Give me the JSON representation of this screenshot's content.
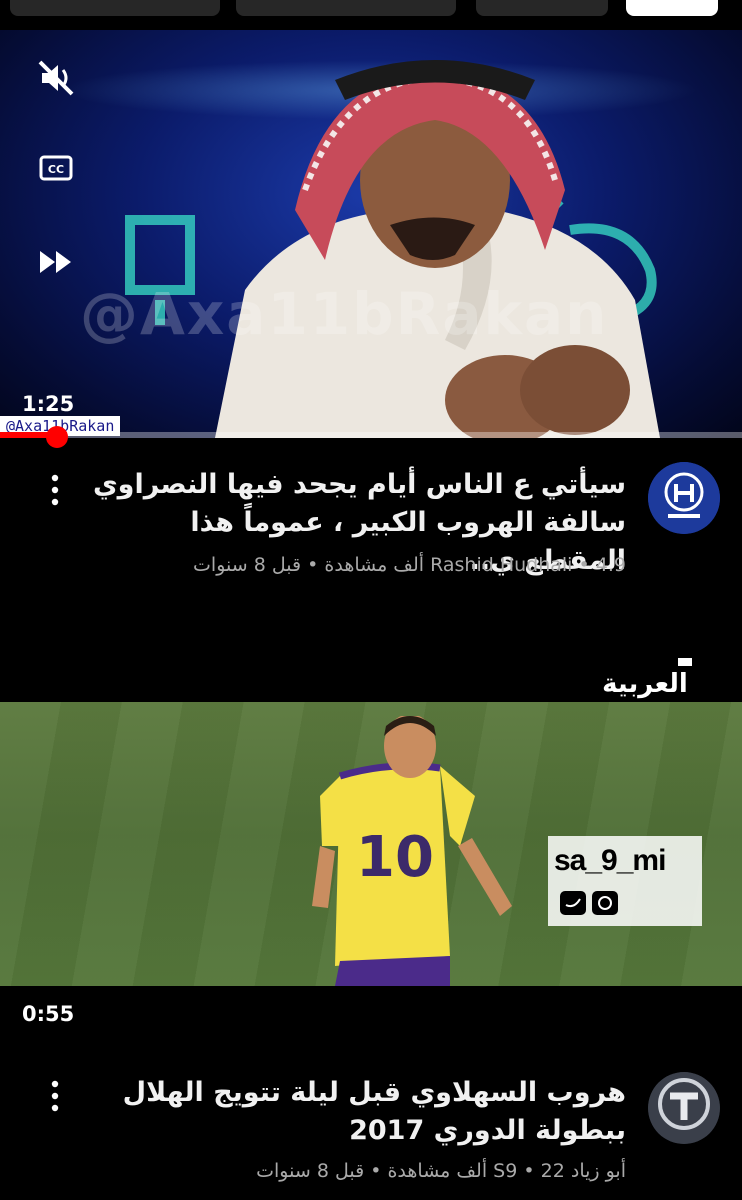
{
  "video1": {
    "timestamp": "1:25",
    "watermark": "@Axa11bRakan",
    "tag": "@Axa11bRakan",
    "progress": 0.09,
    "title_line1": "سيأتي ع الناس أيام يجحد فيها النصراوي",
    "title_line2": "سالفة الهروب الكبير ، عموماً هذا المقطع ي..",
    "channel": "Rashid Hudhali",
    "views": "4.9 ألف مشاهدة",
    "age": "قبل 8 سنوات",
    "sep": "•",
    "icons": [
      "volume-off-icon",
      "closed-captions-icon",
      "fast-forward-icon",
      "more-vert-icon"
    ]
  },
  "video2": {
    "timestamp": "0:55",
    "brand": "العربية",
    "overlay_handle": "sa_9_mi",
    "jersey_number": "10",
    "title_line1": "هروب السهلاوي قبل ليلة تتويج الهلال",
    "title_line2": "ببطولة الدوري 2017",
    "channel": "أبو زياد S9",
    "views": "22 ألف مشاهدة",
    "age": "قبل 8 سنوات",
    "sep": "•"
  },
  "colors": {
    "progress": "#ff0000",
    "text": "#f1f1f1",
    "meta": "#aaaaaa",
    "avatar1": "#1d3a9c"
  }
}
